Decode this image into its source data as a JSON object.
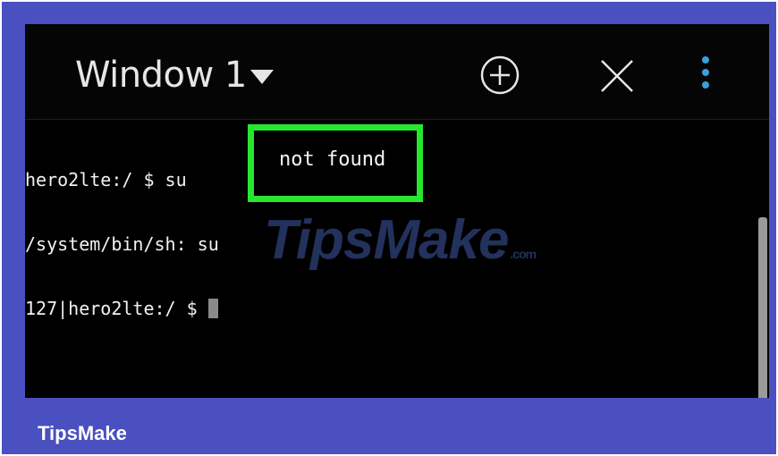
{
  "toolbar": {
    "window_title": "Window 1",
    "icons": {
      "add": "plus-circle-icon",
      "close": "close-icon",
      "menu": "kebab-menu-icon"
    },
    "icon_color": "#e6e6e6",
    "menu_dots_color": "#3aa0d8"
  },
  "terminal": {
    "lines": [
      "hero2lte:/ $ su",
      "/system/bin/sh: su",
      "127|hero2lte:/ $ "
    ],
    "highlight_text": "not found",
    "highlight_color": "#27e62f"
  },
  "watermark": {
    "brand": "TipsMake",
    "tld": ".com"
  },
  "caption": {
    "label": "TipsMake"
  },
  "colors": {
    "frame_blue": "#4a50c0",
    "screen_bg": "#000000"
  }
}
